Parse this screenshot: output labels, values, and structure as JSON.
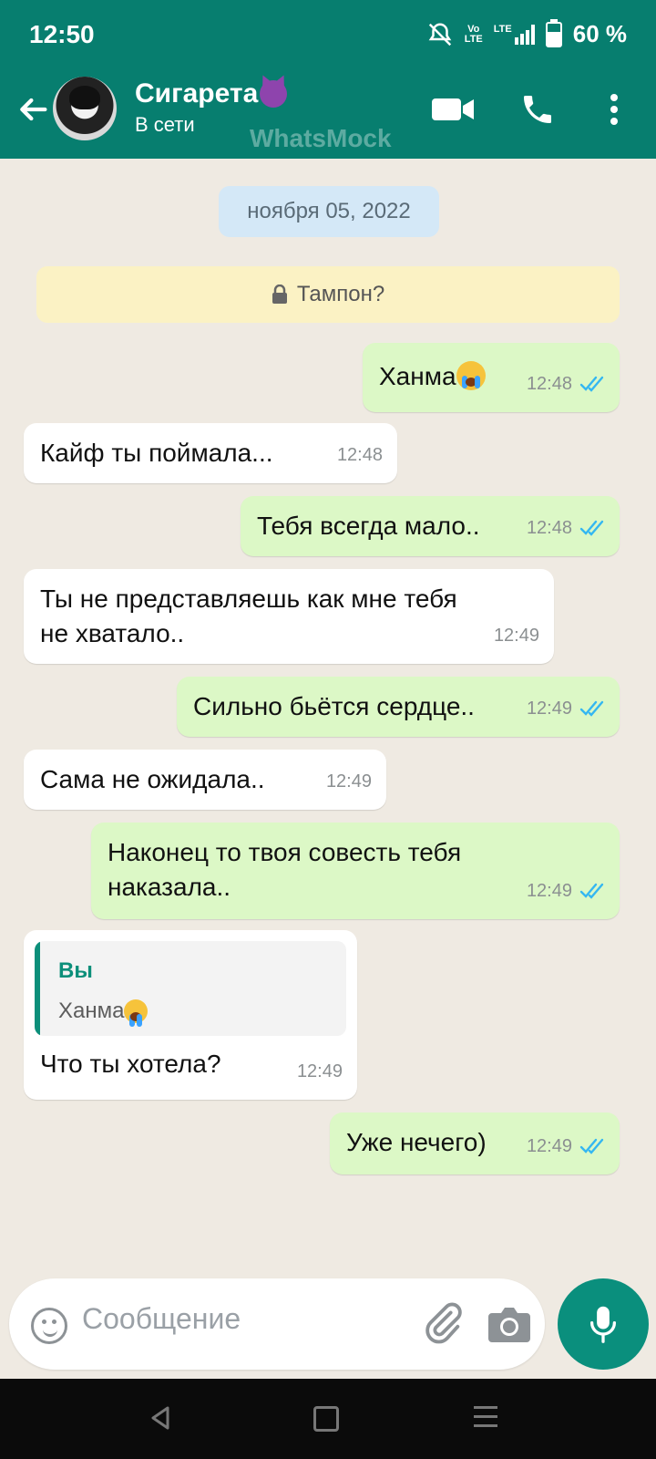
{
  "status_bar": {
    "time": "12:50",
    "network_label_top": "Vo",
    "network_label_bottom": "LTE",
    "lte": "LTE",
    "battery_text": "60 %",
    "battery_level": 0.6
  },
  "header": {
    "contact_name": "Сигарета",
    "contact_status": "В сети",
    "watermark": "WhatsMock"
  },
  "chat": {
    "date": "ноября 05, 2022",
    "encryption_notice": "Тампон?",
    "messages": [
      {
        "dir": "out",
        "text": "Ханма",
        "time": "12:48"
      },
      {
        "dir": "in",
        "text": "Кайф ты поймала...",
        "time": "12:48"
      },
      {
        "dir": "out",
        "text": "Тебя всегда мало..",
        "time": "12:48"
      },
      {
        "dir": "in",
        "text_line1": "Ты не представляешь как мне тебя",
        "text_line2": "не хватало..",
        "time": "12:49"
      },
      {
        "dir": "out",
        "text": "Сильно бьётся сердце..",
        "time": "12:49"
      },
      {
        "dir": "in",
        "text": "Сама не ожидала..",
        "time": "12:49"
      },
      {
        "dir": "out",
        "text_line1": "Наконец то твоя совесть тебя",
        "text_line2": "наказала..",
        "time": "12:49"
      },
      {
        "dir": "in",
        "reply_author": "Вы",
        "reply_text": "Ханма",
        "text": "Что ты хотела?",
        "time": "12:49"
      },
      {
        "dir": "out",
        "text": "Уже нечего)",
        "time": "12:49"
      }
    ]
  },
  "input": {
    "placeholder": "Сообщение"
  },
  "colors": {
    "header": "#077e6f",
    "outgoing": "#dcf8c6",
    "incoming": "#ffffff",
    "tick": "#34b7f1",
    "mic": "#0a8f7d"
  }
}
